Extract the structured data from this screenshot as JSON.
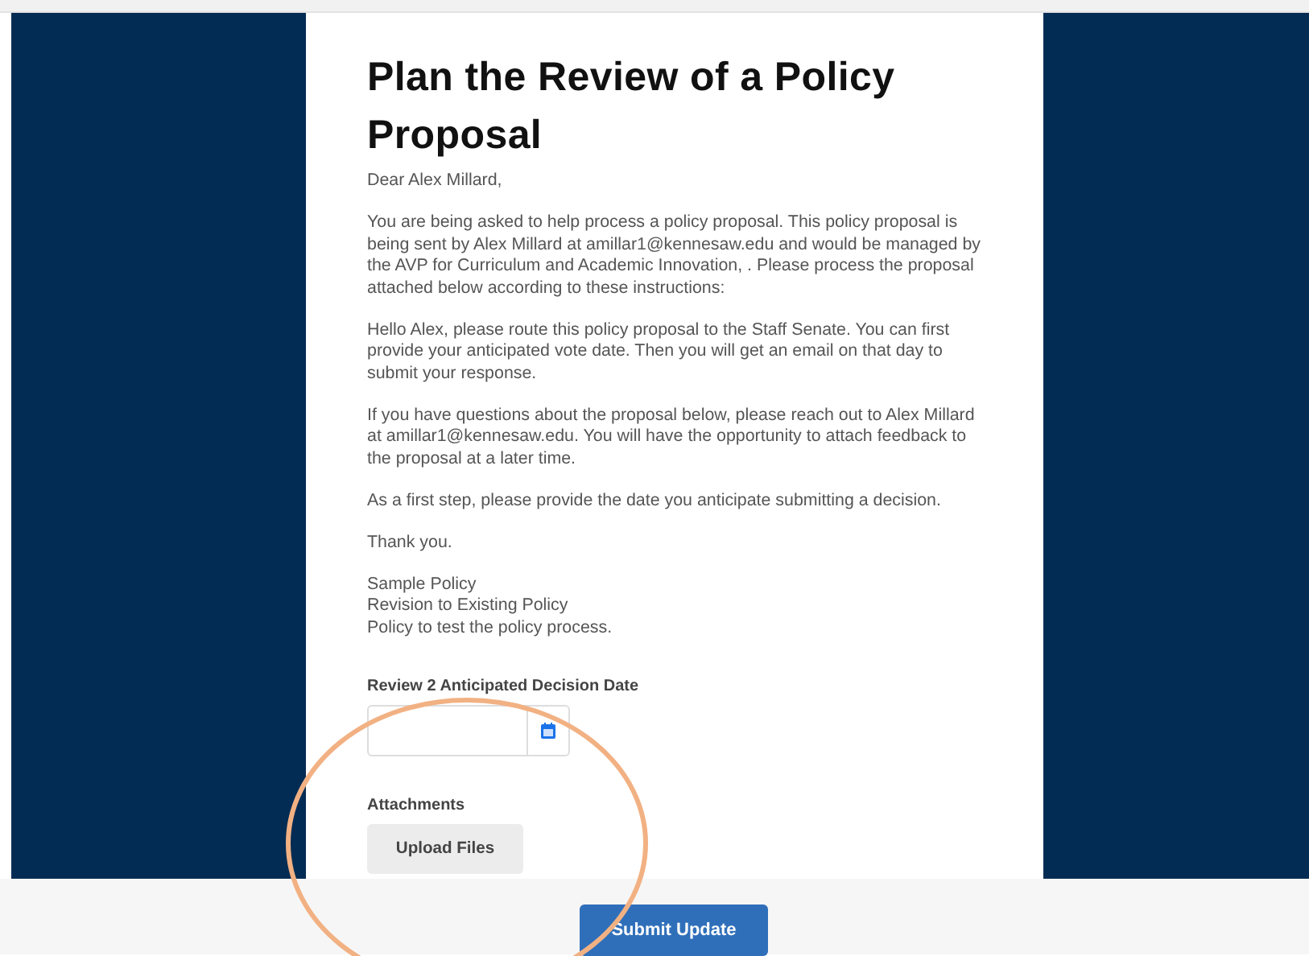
{
  "title": "Plan the Review of a Policy Proposal",
  "greeting": "Dear Alex Millard,",
  "paragraphs": [
    "You are being asked to help process a policy proposal.  This policy proposal is being sent by Alex Millard at amillar1@kennesaw.edu and would be managed by the AVP for Curriculum and Academic Innovation, . Please process the proposal attached below according to these instructions:",
    "Hello Alex, please route this policy proposal to the Staff Senate. You can first provide your anticipated vote date.  Then you will get an email on that day to submit your response.",
    "If you have questions about the proposal below, please reach out to Alex Millard at amillar1@kennesaw.edu. You will have the opportunity to attach feedback to the proposal at a later time.",
    "As a first step, please provide the date you anticipate submitting a decision.",
    "Thank you."
  ],
  "policy_lines": [
    "Sample Policy",
    "Revision to Existing Policy",
    "Policy to test the policy process."
  ],
  "date_field": {
    "label": "Review 2 Anticipated Decision Date"
  },
  "attachments": {
    "label": "Attachments",
    "button": "Upload Files"
  },
  "submit_button": "Submit Update"
}
